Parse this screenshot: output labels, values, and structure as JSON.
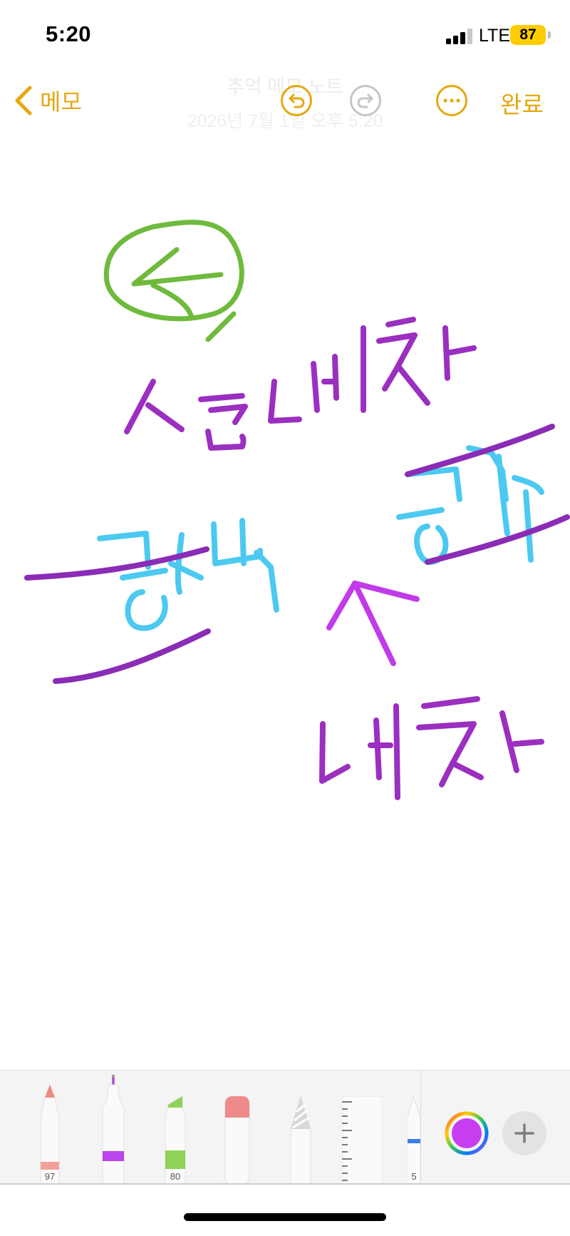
{
  "status_bar": {
    "time": "5:20",
    "network": "LTE",
    "battery": "87"
  },
  "nav": {
    "back_label": "메모",
    "done_label": "완료",
    "ghost_title": "추억 메모 노트",
    "ghost_date": "2026년 7월 1일 오후 5:20",
    "accent_color": "#e6a80f"
  },
  "drawing": {
    "strokes_colors": {
      "purple": "#9a2fc0",
      "light_purple": "#c13be8",
      "cyan": "#4cc9f0",
      "green": "#6fba3c"
    }
  },
  "tools": {
    "pen_number": "97",
    "marker_number": "80",
    "crayon_number": "5"
  },
  "color_well": {
    "selected": "#c63ef0"
  }
}
